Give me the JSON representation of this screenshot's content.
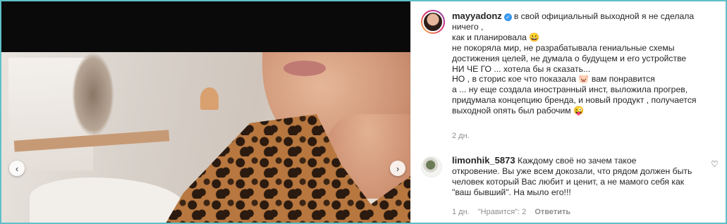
{
  "post": {
    "username": "mayyadonz",
    "caption_lines": [
      "в свой официальный выходной я не сделала",
      "ничего ,",
      "как и планировала 😀",
      "не покоряла мир, не разрабатывала гениальные схемы",
      "достижения целей, не думала о будущем и его устройстве",
      "НИ ЧЕ ГО ... хотела бы я сказать...",
      "НО , в сторис кое что показала 🐷 вам понравится",
      "а ... ну еще создала иностранный инст, выложила прогрев,",
      "придумала концепцию бренда, и новый продукт , получается",
      "выходной опять был рабочим 😜"
    ],
    "time": "2 дн."
  },
  "comment": {
    "username": "limonhik_5873",
    "text_lines": [
      "Каждому своё но зачем такое",
      "откровение. Вы уже всем докозали, что рядом должен быть",
      "человек который Вас любит и ценит, а не мамого себя как",
      "\"ваш бывший\". На мыло его!!!"
    ],
    "time": "1 дн.",
    "likes": "\"Нравится\": 2",
    "reply_label": "Ответить"
  },
  "icons": {
    "verified": "verified-badge-icon",
    "heart": "heart-icon",
    "prev": "chevron-left-icon",
    "next": "chevron-right-icon"
  },
  "colors": {
    "verified": "#3897f0",
    "muted": "#8e8e8e",
    "text": "#262626"
  }
}
